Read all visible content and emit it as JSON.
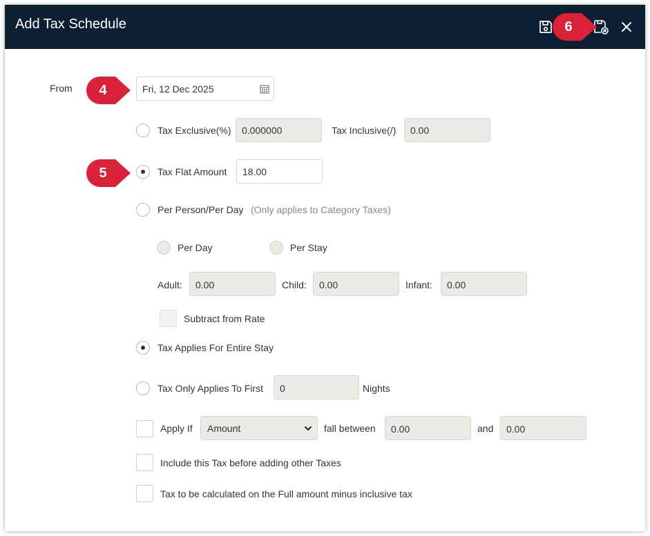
{
  "dialog": {
    "title": "Add Tax Schedule",
    "icons": {
      "save": "save-icon",
      "save_close": "save-close-icon",
      "close": "close-icon"
    }
  },
  "from": {
    "label": "From",
    "value": "Fri, 12 Dec 2025",
    "icon": "calendar-icon"
  },
  "tax_exclusive": {
    "label": "Tax Exclusive(%)",
    "value": "0.000000"
  },
  "tax_inclusive": {
    "label": "Tax Inclusive(/)",
    "value": "0.00"
  },
  "tax_flat_amount": {
    "label": "Tax Flat Amount",
    "value": "18.00",
    "selected": true
  },
  "per_person": {
    "label": "Per Person/Per Day",
    "hint": "(Only applies to Category Taxes)"
  },
  "per_day": {
    "label": "Per Day"
  },
  "per_stay": {
    "label": "Per Stay"
  },
  "adult": {
    "label": "Adult:",
    "value": "0.00"
  },
  "child": {
    "label": "Child:",
    "value": "0.00"
  },
  "infant": {
    "label": "Infant:",
    "value": "0.00"
  },
  "subtract_from_rate": {
    "label": "Subtract from Rate"
  },
  "entire_stay": {
    "label": "Tax Applies For Entire Stay",
    "selected": true
  },
  "first_nights": {
    "label": "Tax Only Applies To First",
    "value": "0",
    "suffix": "Nights"
  },
  "apply_if": {
    "label": "Apply If",
    "selected": "Amount",
    "between_label": "fall between",
    "from_value": "0.00",
    "and_label": "and",
    "to_value": "0.00"
  },
  "include_before": {
    "label": "Include this Tax before adding other Taxes"
  },
  "full_amount": {
    "label": "Tax to be calculated on the Full amount minus inclusive tax"
  },
  "callouts": [
    "4",
    "5",
    "6"
  ],
  "colors": {
    "header_bg": "#0d1f33",
    "callout": "#d9213a",
    "disabled_field": "#ebeae5"
  }
}
